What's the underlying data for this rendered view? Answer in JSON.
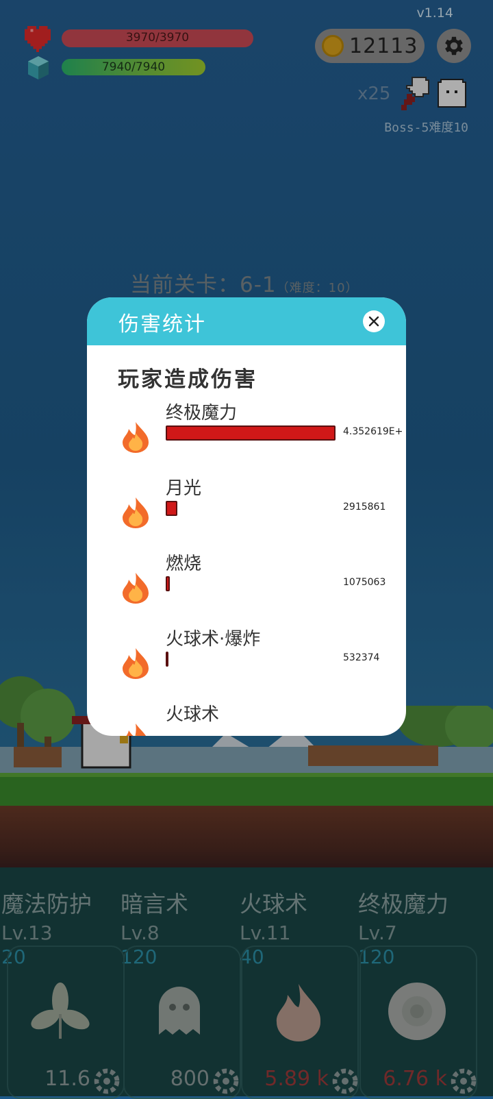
{
  "hud": {
    "version": "v1.14",
    "version_ghost": "0.0",
    "hp_text": "3970/3970",
    "mp_text": "7940/7940",
    "coins": "12113",
    "boss_multiplier": "x25",
    "boss_info": "Boss-5难度10",
    "icons": [
      "heart-icon",
      "gem-icon",
      "coin-icon",
      "gear-icon",
      "cleaver-icon",
      "ghost-boss-icon"
    ]
  },
  "stage": {
    "label": "当前关卡：6-1",
    "difficulty": "（难度：10）"
  },
  "modal": {
    "title": "伤害统计",
    "section_title": "玩家造成伤害",
    "rows": [
      {
        "name": "终极魔力",
        "value": "4.352619E+",
        "share": 1.0
      },
      {
        "name": "月光",
        "value": "2915861",
        "share": 0.067
      },
      {
        "name": "燃烧",
        "value": "1075063",
        "share": 0.025
      },
      {
        "name": "火球术·爆炸",
        "value": "532374",
        "share": 0.012
      },
      {
        "name": "火球术",
        "value": "",
        "share": 0.0
      }
    ]
  },
  "skills": [
    {
      "name": "魔法防护",
      "level": "Lv.13",
      "cost": "20",
      "value": "11.6",
      "value_red": false,
      "icon": "leaf-icon"
    },
    {
      "name": "暗言术",
      "level": "Lv.8",
      "cost": "120",
      "value": "800",
      "value_red": false,
      "icon": "ghost-icon"
    },
    {
      "name": "火球术",
      "level": "Lv.11",
      "cost": "40",
      "value": "5.89 k",
      "value_red": true,
      "icon": "fire-icon"
    },
    {
      "name": "终极魔力",
      "level": "Lv.7",
      "cost": "120",
      "value": "6.76 k",
      "value_red": true,
      "icon": "orb-icon"
    }
  ],
  "colors": {
    "header": "#3ec4d8",
    "damage_bar": "#d01818",
    "hp_bar": "#c94a55"
  }
}
